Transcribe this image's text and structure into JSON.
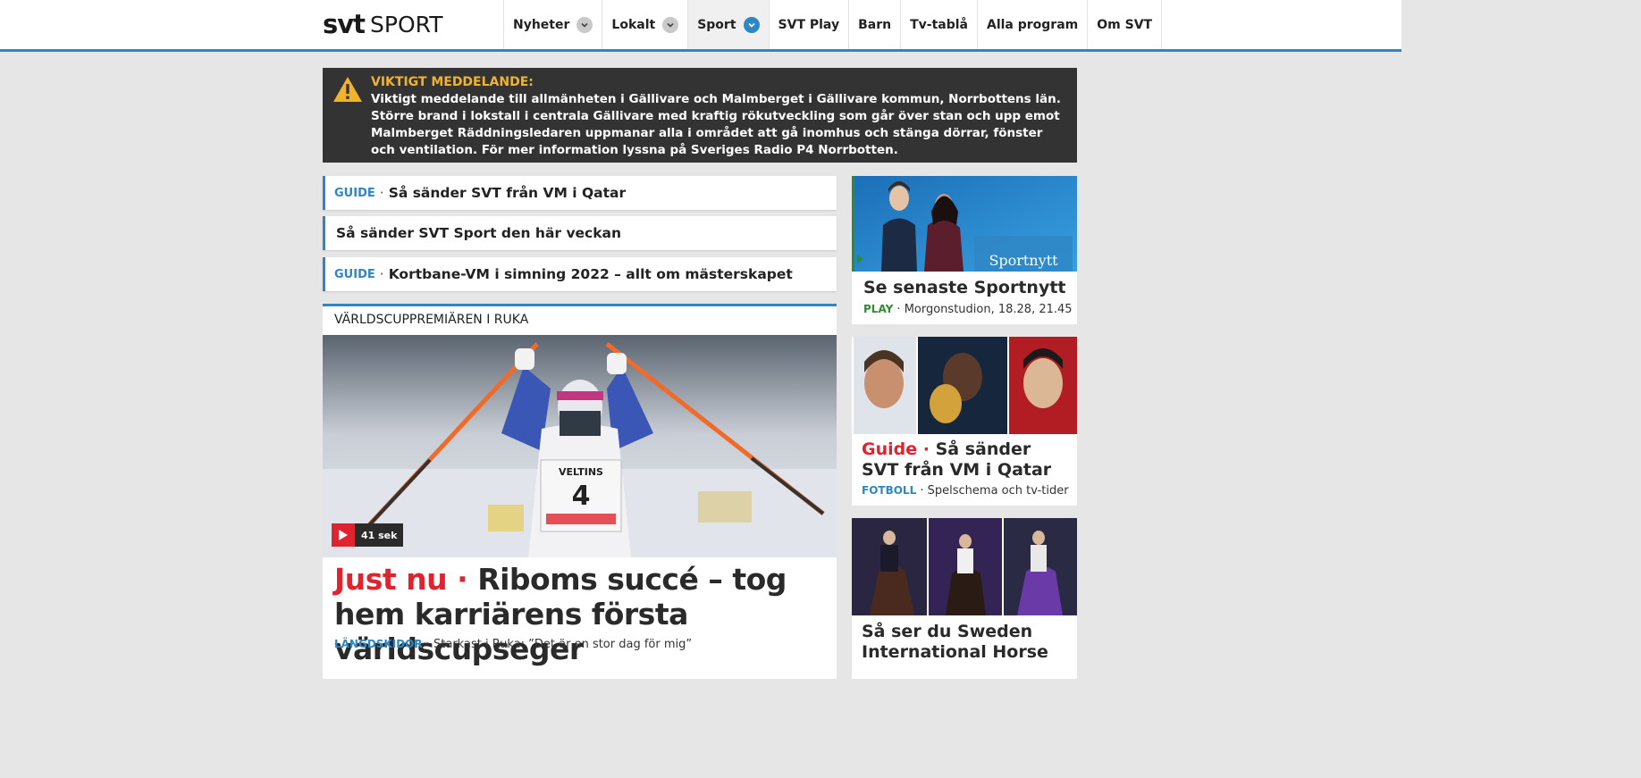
{
  "header": {
    "logo_svt": "svt",
    "logo_sport": "SPORT",
    "nav": [
      {
        "label": "Nyheter",
        "dropdown": true
      },
      {
        "label": "Lokalt",
        "dropdown": true
      },
      {
        "label": "Sport",
        "dropdown": true,
        "active": true
      },
      {
        "label": "SVT Play"
      },
      {
        "label": "Barn"
      },
      {
        "label": "Tv-tablå"
      },
      {
        "label": "Alla program"
      },
      {
        "label": "Om SVT"
      }
    ]
  },
  "alert": {
    "title": "VIKTIGT MEDDELANDE:",
    "body": "Viktigt meddelande till allmänheten i Gällivare och Malmberget i Gällivare kommun, Norrbottens län. Större brand i lokstall i centrala Gällivare med kraftig rökutveckling som går över stan och upp emot Malmberget Räddningsledaren uppmanar alla i området att gå inomhus och stänga dörrar, fönster och ventilation. För mer information lyssna på Sveriges Radio P4 Norrbotten."
  },
  "links": [
    {
      "tag": "GUIDE",
      "text": "Så sänder SVT från VM i Qatar"
    },
    {
      "tag": "",
      "text": "Så sänder SVT Sport den här veckan"
    },
    {
      "tag": "GUIDE",
      "text": "Kortbane-VM i simning 2022 – allt om mästerskapet"
    }
  ],
  "main_story": {
    "kicker": "VÄRLDSCUPPREMIÄREN I RUKA",
    "video_length": "41 sek",
    "bib_text": "VELTINS",
    "bib_number": "4",
    "headline_prefix": "Just nu",
    "headline": "Riboms succé – tog hem karriärens första världscupseger",
    "category": "LÄNGDSKIDOR",
    "subtext": "Starkast i Ruka: ”Det är en stor dag för mig”"
  },
  "right": {
    "sportnytt": {
      "overlay": "Sportnytt",
      "title": "Se senaste Sportnytt",
      "tag": "PLAY",
      "text": "Morgonstudion, 18.28, 21.45"
    },
    "guide": {
      "prefix": "Guide",
      "title": "Så sänder SVT från VM i Qatar",
      "tag": "FOTBOLL",
      "text": "Spelschema och tv-tider"
    },
    "horse": {
      "title": "Så ser du Sweden International Horse"
    }
  },
  "colors": {
    "accent": "#2f86c4",
    "alert_title": "#f2b32c",
    "live_red": "#e0242f",
    "play_green": "#2e8b2e"
  }
}
